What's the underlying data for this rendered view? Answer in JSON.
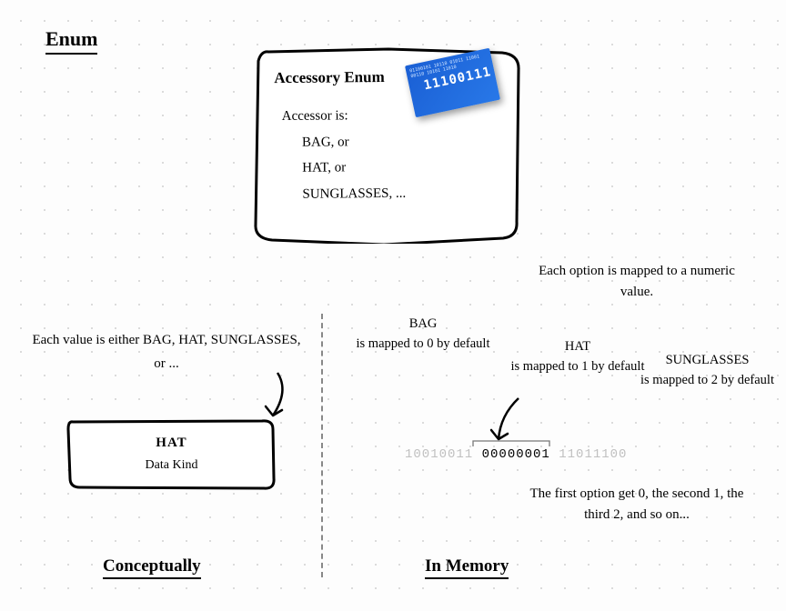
{
  "title": "Enum",
  "enum_box": {
    "title": "Accessory Enum",
    "heading": "Accessor is:",
    "options": [
      "BAG, or",
      "HAT, or",
      "SUNGLASSES, ..."
    ]
  },
  "binary_card": {
    "big": "11100111",
    "small": "01100101 10110 01011 11001 00110 10101 11010"
  },
  "caption_right": "Each option is mapped to a numeric value.",
  "caption_left": "Each value is either BAG, HAT, SUNGLASSES, or ...",
  "small_box": {
    "value": "HAT",
    "subtitle": "Data Kind"
  },
  "memory_labels": {
    "bag": {
      "name": "BAG",
      "text": "is mapped to 0 by default"
    },
    "hat": {
      "name": "HAT",
      "text": "is mapped to 1 by default"
    },
    "sun": {
      "name": "SUNGLASSES",
      "text": "is mapped to 2 by default"
    }
  },
  "binary_row": {
    "left": "10010011",
    "mid": "00000001",
    "right": "11011100"
  },
  "footer_caption": "The first option get 0, the second 1, the third 2, and so on...",
  "sections": {
    "conceptual": "Conceptually",
    "memory": "In Memory"
  }
}
